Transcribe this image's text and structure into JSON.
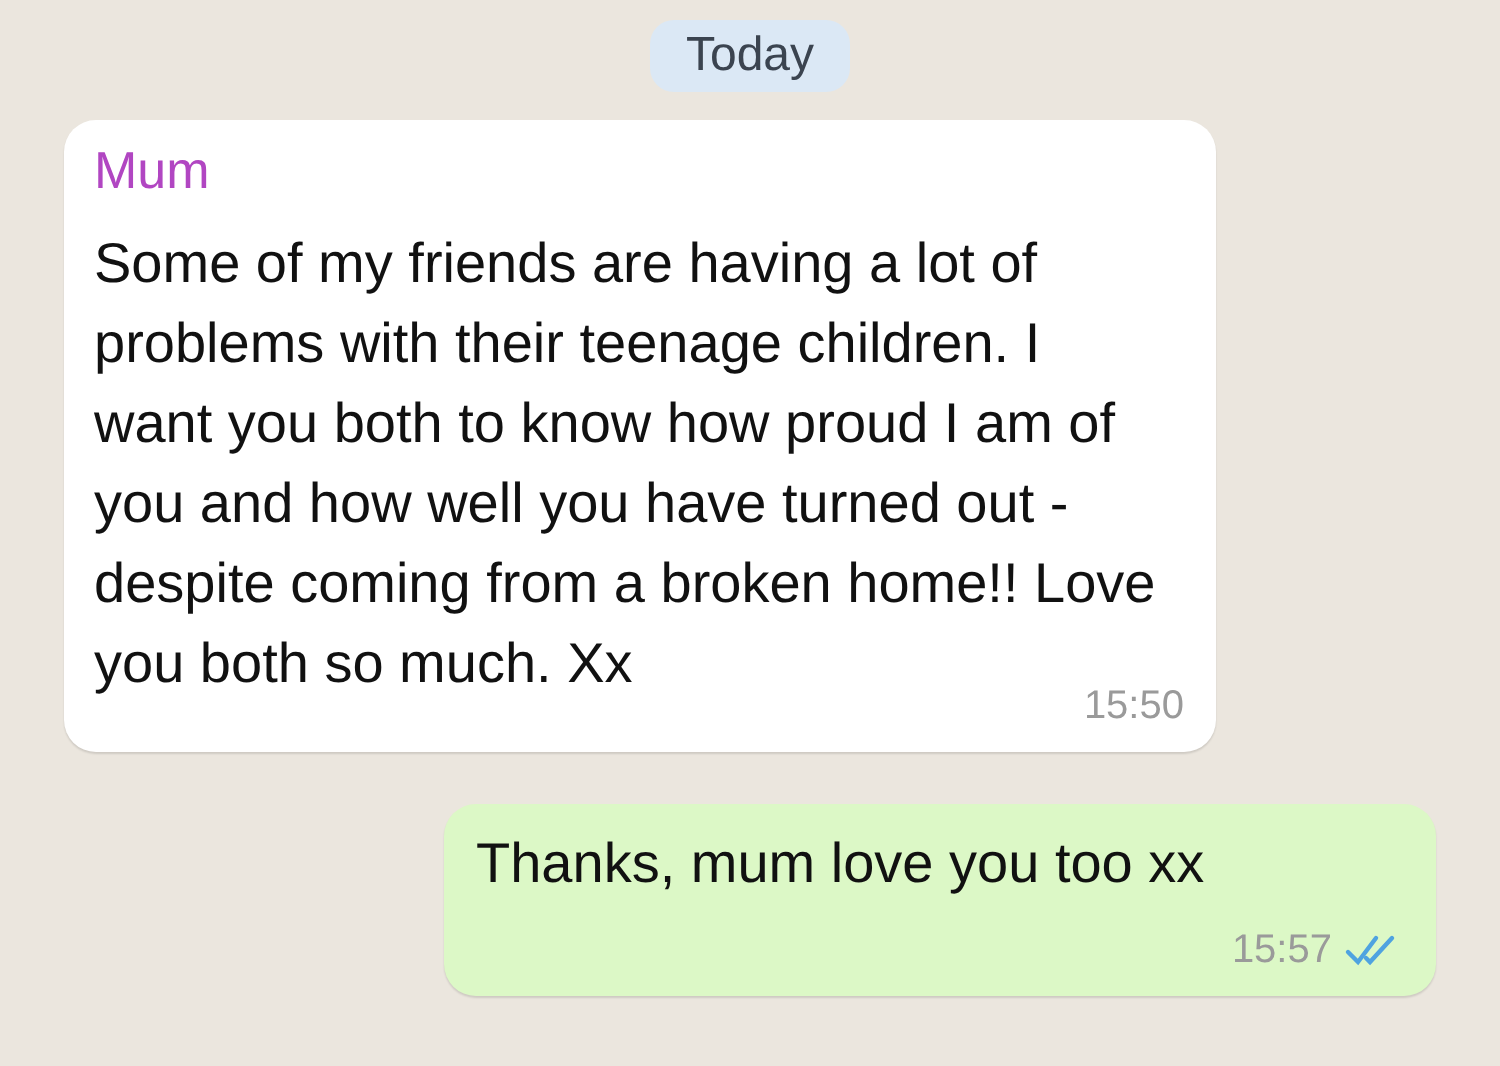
{
  "date_divider": "Today",
  "messages": [
    {
      "kind": "incoming",
      "sender": "Mum",
      "text": "Some of my friends are having a lot of problems with their teenage children. I want you both to know how proud I am of you and how well you have turned out - despite coming from a broken home!! Love you both so much. Xx",
      "time": "15:50"
    },
    {
      "kind": "outgoing",
      "text": "Thanks, mum love you too xx",
      "time": "15:57",
      "read": true
    }
  ]
}
